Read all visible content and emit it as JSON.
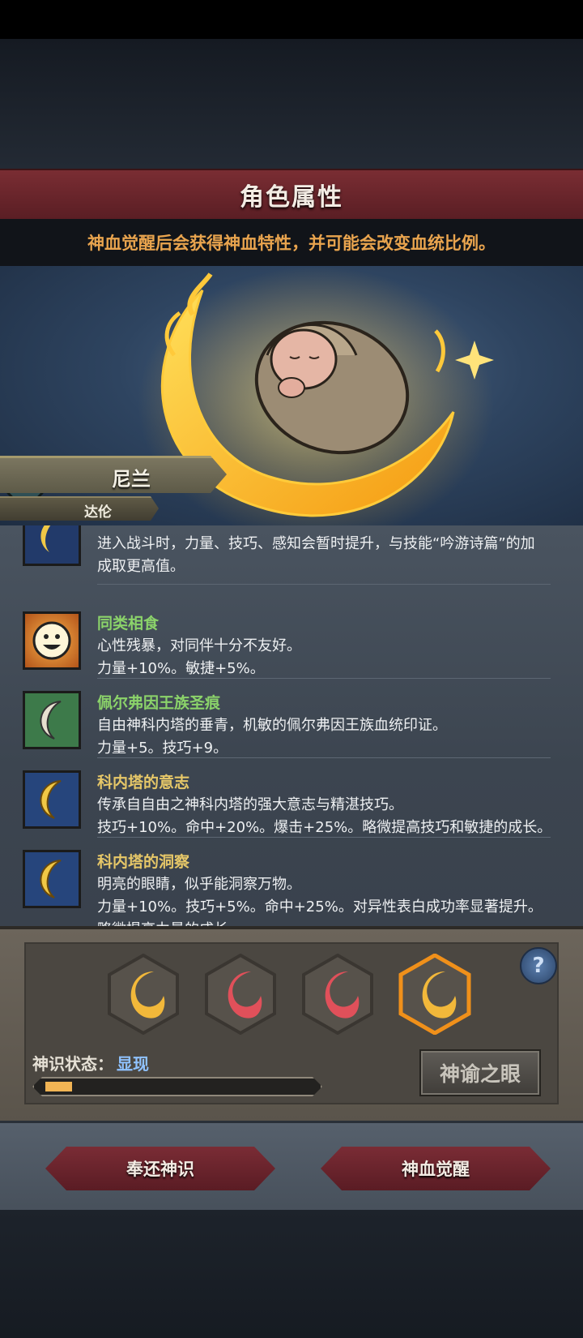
{
  "header": {
    "title": "角色属性",
    "subtitle": "神血觉醒后会获得神血特性，并可能会改变血统比例。"
  },
  "character": {
    "name": "尼兰",
    "house": "达伦"
  },
  "traits": [
    {
      "name": "",
      "icon": "moon-icon",
      "lines": [
        "进入战斗时，力量、技巧、感知会暂时提升，与技能“吟游诗篇”的加",
        "成取更高值。"
      ]
    },
    {
      "name": "同类相食",
      "color": "#8bd36a",
      "icon": "smile-face-icon",
      "lines": [
        "心性残暴，对同伴十分不友好。",
        "力量+10%。敏捷+5%。"
      ]
    },
    {
      "name": "佩尔弗因王族圣痕",
      "color": "#8bd36a",
      "icon": "crescent-green-icon",
      "lines": [
        "自由神科内塔的垂青，机敏的佩尔弗因王族血统印证。",
        "力量+5。技巧+9。"
      ]
    },
    {
      "name": "科内塔的意志",
      "color": "#e6c768",
      "icon": "crescent-blue-icon",
      "lines": [
        "传承自自由之神科内塔的强大意志与精湛技巧。",
        "技巧+10%。命中+20%。爆击+25%。略微提高技巧和敏捷的成长。"
      ]
    },
    {
      "name": "科内塔的洞察",
      "color": "#e6c768",
      "icon": "crescent-blue-icon",
      "lines": [
        "明亮的眼睛，似乎能洞察万物。",
        "力量+10%。技巧+5%。命中+25%。对异性表白成功率显著提升。",
        "略微提高力量的成长。"
      ]
    }
  ],
  "divine_slots": [
    {
      "icon": "gold-crescent-icon",
      "color": "#f2b83a",
      "selected": false
    },
    {
      "icon": "red-crescent-icon",
      "color": "#e0505a",
      "selected": false
    },
    {
      "icon": "red-crescent-icon",
      "color": "#e0505a",
      "selected": false
    },
    {
      "icon": "gold-crescent-icon",
      "color": "#f2b83a",
      "selected": true
    }
  ],
  "status": {
    "label": "神识状态：",
    "value": "显现",
    "progress": 0.1
  },
  "buttons": {
    "oracle": "神谕之眼",
    "return": "奉还神识",
    "awaken": "神血觉醒",
    "help": "?"
  },
  "colors": {
    "title_bar": "#6a252c",
    "subtitle_text": "#e9a44e",
    "status_value": "#8fc2ff",
    "progress_fill": "#f1b454"
  }
}
